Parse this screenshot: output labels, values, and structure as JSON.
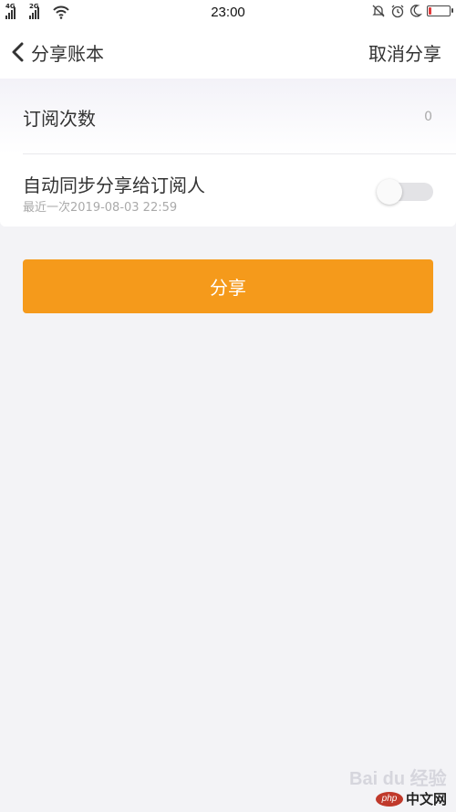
{
  "status_bar": {
    "network1": "4G",
    "network2": "2G",
    "time": "23:00",
    "battery_level": 0.15,
    "battery_color": "#e23b3b",
    "icons": [
      "signal-icon",
      "wifi-icon",
      "mute-bell-icon",
      "alarm-icon",
      "moon-icon",
      "battery-icon"
    ]
  },
  "nav": {
    "back_icon": "chevron-left-icon",
    "title": "分享账本",
    "action": "取消分享"
  },
  "settings": {
    "subscribers_label": "订阅次数",
    "subscribers_count": "0",
    "auto_sync_label": "自动同步分享给订阅人",
    "last_sync": "最近一次2019-08-03 22:59",
    "auto_sync_on": false
  },
  "share_button": {
    "label": "分享",
    "color": "#f59a1b"
  },
  "watermark": {
    "baidu": "Bai du 经验",
    "php_badge": "php",
    "php_site": "中文网"
  }
}
